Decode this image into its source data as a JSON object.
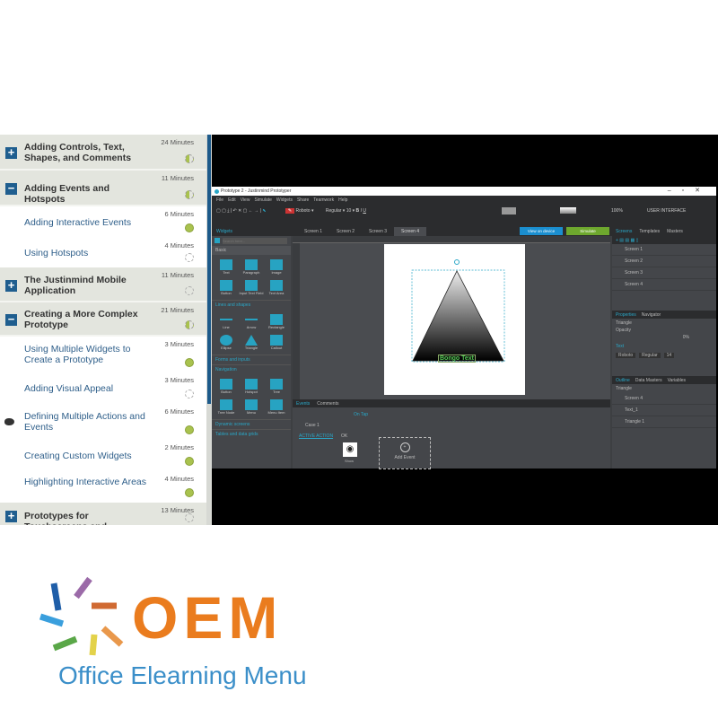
{
  "course": {
    "sections": [
      {
        "type": "header",
        "expanded": false,
        "title": "Adding Controls, Text, Shapes, and Comments",
        "duration": "24 Minutes",
        "status": "half"
      },
      {
        "type": "header",
        "expanded": true,
        "title": "Adding Events and Hotspots",
        "duration": "11 Minutes",
        "status": "half"
      },
      {
        "type": "item",
        "title": "Adding Interactive Events",
        "duration": "6 Minutes",
        "status": "full"
      },
      {
        "type": "item",
        "title": "Using Hotspots",
        "duration": "4 Minutes",
        "status": "none"
      },
      {
        "type": "header",
        "expanded": false,
        "title": "The Justinmind Mobile Application",
        "duration": "11 Minutes",
        "status": "none"
      },
      {
        "type": "header",
        "expanded": true,
        "title": "Creating a More Complex Prototype",
        "duration": "21 Minutes",
        "status": "half"
      },
      {
        "type": "item",
        "title": "Using Multiple Widgets to Create a Prototype",
        "duration": "3 Minutes",
        "status": "full"
      },
      {
        "type": "item",
        "title": "Adding Visual Appeal",
        "duration": "3 Minutes",
        "status": "none"
      },
      {
        "type": "item",
        "title": "Defining Multiple Actions and Events",
        "duration": "6 Minutes",
        "status": "full",
        "current": true
      },
      {
        "type": "item",
        "title": "Creating Custom Widgets",
        "duration": "2 Minutes",
        "status": "full"
      },
      {
        "type": "item",
        "title": "Highlighting Interactive Areas",
        "duration": "4 Minutes",
        "status": "full"
      },
      {
        "type": "header",
        "expanded": false,
        "title": "Prototypes for Touchscreens and",
        "duration": "13 Minutes",
        "status": "none"
      }
    ]
  },
  "app": {
    "title": "Prototype 2 - Justinmind Prototyper",
    "menu": [
      "File",
      "Edit",
      "View",
      "Simulate",
      "Widgets",
      "Share",
      "Teamwork",
      "Help"
    ],
    "toolbar": {
      "font": "Roboto",
      "weight": "Regular",
      "size": "10",
      "zoom": "100%",
      "mode": "USER INTERFACE"
    },
    "screen_tabs": [
      "Screen 1",
      "Screen 2",
      "Screen 3",
      "Screen 4"
    ],
    "view_on_device": "View on device",
    "simulate": "Simulate",
    "widgets": {
      "tab": "Widgets",
      "search_placeholder": "Search here...",
      "basic": "Basic",
      "basic_items": [
        "Text",
        "Paragraph",
        "Image",
        "Button",
        "Input Text Field",
        "Text Area"
      ],
      "shapes_header": "Lines and shapes",
      "shapes": [
        "Line",
        "Arrow",
        "Rectangle",
        "Ellipse",
        "Triangle",
        "Callout"
      ],
      "forms_header": "Forms and inputs",
      "nav_header": "Navigation",
      "nav": [
        "Button",
        "Hotspot",
        "Tree",
        "Tree Node",
        "Menu",
        "Menu Item"
      ],
      "more": [
        "Dynamic screens",
        "Tables and data grids"
      ]
    },
    "canvas": {
      "shape_text": "Bongo Text"
    },
    "events": {
      "tabs": [
        "Events",
        "Comments"
      ],
      "event": "On Tap",
      "condition": "Case 1",
      "action_link": "ACTIVE ACTION",
      "else": "OK",
      "action": "Show",
      "add_event": "Add Event"
    },
    "right": {
      "tabs": [
        "Screens",
        "Templates",
        "Masters"
      ],
      "screens": [
        "Screen 1",
        "Screen 2",
        "Screen 3",
        "Screen 4"
      ],
      "prop_tabs": [
        "Properties",
        "Navigator"
      ],
      "selected": "Triangle",
      "opacity_label": "Opacity",
      "opacity": "0%",
      "text_label": "Text",
      "font": "Roboto",
      "weight": "Regular",
      "size": "14",
      "outline_tabs": [
        "Outline",
        "Data Masters",
        "Variables"
      ],
      "outline": [
        "Screen 4",
        "Text_1",
        "Triangle 1"
      ]
    }
  },
  "logo": {
    "brand": "OEM",
    "tagline": "Office Elearning Menu",
    "colors": {
      "orange": "#ea7c1e",
      "blue": "#3b8fc9"
    }
  }
}
